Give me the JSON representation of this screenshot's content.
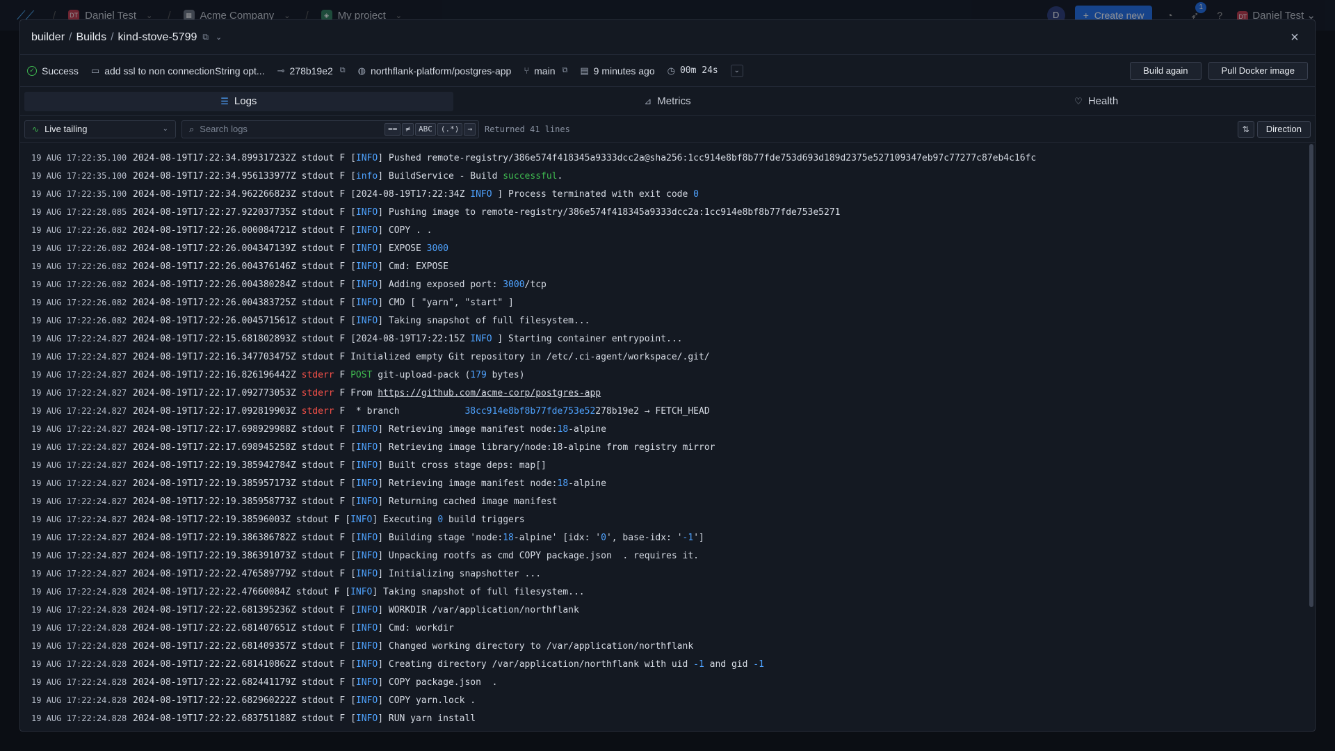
{
  "topnav": {
    "team": "Daniel Test",
    "company": "Acme Company",
    "project": "My project",
    "avatar": "D",
    "create_label": "Create new",
    "notif_count": "1",
    "user": "Daniel Test",
    "team_badge": "DT"
  },
  "header": {
    "crumb_1": "builder",
    "crumb_2": "Builds",
    "crumb_3": "kind-stove-5799"
  },
  "info": {
    "status": "Success",
    "commit_msg": "add ssl to non connectionString opt...",
    "commit_sha": "278b19e2",
    "repo": "northflank-platform/postgres-app",
    "branch": "main",
    "time": "9 minutes ago",
    "duration": "00m 24s",
    "build_again": "Build again",
    "pull_image": "Pull Docker image"
  },
  "tabs": {
    "logs": "Logs",
    "metrics": "Metrics",
    "health": "Health"
  },
  "toolbar": {
    "tailing": "Live tailing",
    "search_placeholder": "Search logs",
    "opt_eq": "==",
    "opt_neq": "≠",
    "opt_abc": "ABC",
    "opt_regex": "(.*)",
    "returned": "Returned 41 lines",
    "direction": "Direction"
  },
  "logs": [
    {
      "ts": "19 AUG 17:22:35.100",
      "parts": [
        [
          "",
          "2024-08-19T17:22:34.899317232Z stdout F ["
        ],
        [
          "blue",
          "INFO"
        ],
        [
          "",
          "] Pushed remote-registry/386e574f418345a9333dcc2a@sha256:1cc914e8bf8b77fde753d693d189d2375e527109347eb97c77277c87eb4c16fc"
        ]
      ]
    },
    {
      "ts": "19 AUG 17:22:35.100",
      "parts": [
        [
          "",
          "2024-08-19T17:22:34.956133977Z stdout F ["
        ],
        [
          "blue",
          "info"
        ],
        [
          "",
          "] BuildService - Build "
        ],
        [
          "green",
          "successful"
        ],
        [
          "",
          "."
        ]
      ]
    },
    {
      "ts": "19 AUG 17:22:35.100",
      "parts": [
        [
          "",
          "2024-08-19T17:22:34.962266823Z stdout F [2024-08-19T17:22:34Z "
        ],
        [
          "blue",
          "INFO"
        ],
        [
          "",
          " ] Process terminated with exit code "
        ],
        [
          "blue",
          "0"
        ]
      ]
    },
    {
      "ts": "19 AUG 17:22:28.085",
      "parts": [
        [
          "",
          "2024-08-19T17:22:27.922037735Z stdout F ["
        ],
        [
          "blue",
          "INFO"
        ],
        [
          "",
          "] Pushing image to remote-registry/386e574f418345a9333dcc2a:1cc914e8bf8b77fde753e5271"
        ]
      ]
    },
    {
      "ts": "19 AUG 17:22:26.082",
      "parts": [
        [
          "",
          "2024-08-19T17:22:26.000084721Z stdout F ["
        ],
        [
          "blue",
          "INFO"
        ],
        [
          "",
          "] COPY . ."
        ]
      ]
    },
    {
      "ts": "19 AUG 17:22:26.082",
      "parts": [
        [
          "",
          "2024-08-19T17:22:26.004347139Z stdout F ["
        ],
        [
          "blue",
          "INFO"
        ],
        [
          "",
          "] EXPOSE "
        ],
        [
          "blue",
          "3000"
        ]
      ]
    },
    {
      "ts": "19 AUG 17:22:26.082",
      "parts": [
        [
          "",
          "2024-08-19T17:22:26.004376146Z stdout F ["
        ],
        [
          "blue",
          "INFO"
        ],
        [
          "",
          "] Cmd: EXPOSE"
        ]
      ]
    },
    {
      "ts": "19 AUG 17:22:26.082",
      "parts": [
        [
          "",
          "2024-08-19T17:22:26.004380284Z stdout F ["
        ],
        [
          "blue",
          "INFO"
        ],
        [
          "",
          "] Adding exposed port: "
        ],
        [
          "blue",
          "3000"
        ],
        [
          "",
          "/tcp"
        ]
      ]
    },
    {
      "ts": "19 AUG 17:22:26.082",
      "parts": [
        [
          "",
          "2024-08-19T17:22:26.004383725Z stdout F ["
        ],
        [
          "blue",
          "INFO"
        ],
        [
          "",
          "] CMD [ \"yarn\", \"start\" ]"
        ]
      ]
    },
    {
      "ts": "19 AUG 17:22:26.082",
      "parts": [
        [
          "",
          "2024-08-19T17:22:26.004571561Z stdout F ["
        ],
        [
          "blue",
          "INFO"
        ],
        [
          "",
          "] Taking snapshot of full filesystem..."
        ]
      ]
    },
    {
      "ts": "19 AUG 17:22:24.827",
      "parts": [
        [
          "",
          "2024-08-19T17:22:15.681802893Z stdout F [2024-08-19T17:22:15Z "
        ],
        [
          "blue",
          "INFO"
        ],
        [
          "",
          " ] Starting container entrypoint..."
        ]
      ]
    },
    {
      "ts": "19 AUG 17:22:24.827",
      "parts": [
        [
          "",
          "2024-08-19T17:22:16.347703475Z stdout F Initialized empty Git repository in /etc/.ci-agent/workspace/.git/"
        ]
      ]
    },
    {
      "ts": "19 AUG 17:22:24.827",
      "parts": [
        [
          "",
          "2024-08-19T17:22:16.826196442Z "
        ],
        [
          "red",
          "stderr"
        ],
        [
          "",
          " F "
        ],
        [
          "green",
          "POST"
        ],
        [
          "",
          " git-upload-pack ("
        ],
        [
          "blue",
          "179"
        ],
        [
          "",
          " bytes)"
        ]
      ]
    },
    {
      "ts": "19 AUG 17:22:24.827",
      "parts": [
        [
          "",
          "2024-08-19T17:22:17.092773053Z "
        ],
        [
          "red",
          "stderr"
        ],
        [
          "",
          " F From "
        ],
        [
          "link",
          "https://github.com/acme-corp/postgres-app"
        ]
      ]
    },
    {
      "ts": "19 AUG 17:22:24.827",
      "parts": [
        [
          "",
          "2024-08-19T17:22:17.092819903Z "
        ],
        [
          "red",
          "stderr"
        ],
        [
          "",
          " F  * branch            "
        ],
        [
          "blue",
          "38cc914e8bf8b77fde753e52"
        ],
        [
          "",
          "278b19e2 → FETCH_HEAD"
        ]
      ]
    },
    {
      "ts": "19 AUG 17:22:24.827",
      "parts": [
        [
          "",
          "2024-08-19T17:22:17.698929988Z stdout F ["
        ],
        [
          "blue",
          "INFO"
        ],
        [
          "",
          "] Retrieving image manifest node:"
        ],
        [
          "blue",
          "18"
        ],
        [
          "",
          "-alpine"
        ]
      ]
    },
    {
      "ts": "19 AUG 17:22:24.827",
      "parts": [
        [
          "",
          "2024-08-19T17:22:17.698945258Z stdout F ["
        ],
        [
          "blue",
          "INFO"
        ],
        [
          "",
          "] Retrieving image library/node:18-alpine from registry mirror"
        ]
      ]
    },
    {
      "ts": "19 AUG 17:22:24.827",
      "parts": [
        [
          "",
          "2024-08-19T17:22:19.385942784Z stdout F ["
        ],
        [
          "blue",
          "INFO"
        ],
        [
          "",
          "] Built cross stage deps: map[]"
        ]
      ]
    },
    {
      "ts": "19 AUG 17:22:24.827",
      "parts": [
        [
          "",
          "2024-08-19T17:22:19.385957173Z stdout F ["
        ],
        [
          "blue",
          "INFO"
        ],
        [
          "",
          "] Retrieving image manifest node:"
        ],
        [
          "blue",
          "18"
        ],
        [
          "",
          "-alpine"
        ]
      ]
    },
    {
      "ts": "19 AUG 17:22:24.827",
      "parts": [
        [
          "",
          "2024-08-19T17:22:19.385958773Z stdout F ["
        ],
        [
          "blue",
          "INFO"
        ],
        [
          "",
          "] Returning cached image manifest"
        ]
      ]
    },
    {
      "ts": "19 AUG 17:22:24.827",
      "parts": [
        [
          "",
          "2024-08-19T17:22:19.38596003Z stdout F ["
        ],
        [
          "blue",
          "INFO"
        ],
        [
          "",
          "] Executing "
        ],
        [
          "blue",
          "0"
        ],
        [
          "",
          " build triggers"
        ]
      ]
    },
    {
      "ts": "19 AUG 17:22:24.827",
      "parts": [
        [
          "",
          "2024-08-19T17:22:19.386386782Z stdout F ["
        ],
        [
          "blue",
          "INFO"
        ],
        [
          "",
          "] Building stage 'node:"
        ],
        [
          "blue",
          "18"
        ],
        [
          "",
          "-alpine' [idx: '"
        ],
        [
          "blue",
          "0"
        ],
        [
          "",
          "', base-idx: '"
        ],
        [
          "blue",
          "-1"
        ],
        [
          "",
          "']"
        ]
      ]
    },
    {
      "ts": "19 AUG 17:22:24.827",
      "parts": [
        [
          "",
          "2024-08-19T17:22:19.386391073Z stdout F ["
        ],
        [
          "blue",
          "INFO"
        ],
        [
          "",
          "] Unpacking rootfs as cmd COPY package.json  . requires it."
        ]
      ]
    },
    {
      "ts": "19 AUG 17:22:24.827",
      "parts": [
        [
          "",
          "2024-08-19T17:22:22.476589779Z stdout F ["
        ],
        [
          "blue",
          "INFO"
        ],
        [
          "",
          "] Initializing snapshotter ..."
        ]
      ]
    },
    {
      "ts": "19 AUG 17:22:24.828",
      "parts": [
        [
          "",
          "2024-08-19T17:22:22.47660084Z stdout F ["
        ],
        [
          "blue",
          "INFO"
        ],
        [
          "",
          "] Taking snapshot of full filesystem..."
        ]
      ]
    },
    {
      "ts": "19 AUG 17:22:24.828",
      "parts": [
        [
          "",
          "2024-08-19T17:22:22.681395236Z stdout F ["
        ],
        [
          "blue",
          "INFO"
        ],
        [
          "",
          "] WORKDIR /var/application/northflank"
        ]
      ]
    },
    {
      "ts": "19 AUG 17:22:24.828",
      "parts": [
        [
          "",
          "2024-08-19T17:22:22.681407651Z stdout F ["
        ],
        [
          "blue",
          "INFO"
        ],
        [
          "",
          "] Cmd: workdir"
        ]
      ]
    },
    {
      "ts": "19 AUG 17:22:24.828",
      "parts": [
        [
          "",
          "2024-08-19T17:22:22.681409357Z stdout F ["
        ],
        [
          "blue",
          "INFO"
        ],
        [
          "",
          "] Changed working directory to /var/application/northflank"
        ]
      ]
    },
    {
      "ts": "19 AUG 17:22:24.828",
      "parts": [
        [
          "",
          "2024-08-19T17:22:22.681410862Z stdout F ["
        ],
        [
          "blue",
          "INFO"
        ],
        [
          "",
          "] Creating directory /var/application/northflank with uid "
        ],
        [
          "blue",
          "-1"
        ],
        [
          "",
          " and gid "
        ],
        [
          "blue",
          "-1"
        ]
      ]
    },
    {
      "ts": "19 AUG 17:22:24.828",
      "parts": [
        [
          "",
          "2024-08-19T17:22:22.682441179Z stdout F ["
        ],
        [
          "blue",
          "INFO"
        ],
        [
          "",
          "] COPY package.json  ."
        ]
      ]
    },
    {
      "ts": "19 AUG 17:22:24.828",
      "parts": [
        [
          "",
          "2024-08-19T17:22:22.682960222Z stdout F ["
        ],
        [
          "blue",
          "INFO"
        ],
        [
          "",
          "] COPY yarn.lock ."
        ]
      ]
    },
    {
      "ts": "19 AUG 17:22:24.828",
      "parts": [
        [
          "",
          "2024-08-19T17:22:22.683751188Z stdout F ["
        ],
        [
          "blue",
          "INFO"
        ],
        [
          "",
          "] RUN yarn install"
        ]
      ]
    }
  ]
}
